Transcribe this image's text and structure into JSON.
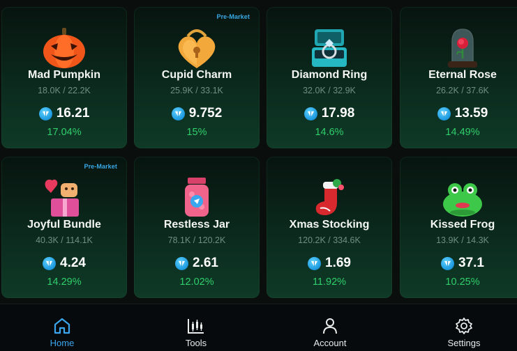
{
  "cards": [
    {
      "name": "Mad Pumpkin",
      "supply": "18.0K / 22.2K",
      "price": "16.21",
      "change": "17.04%",
      "badge": "",
      "icon": "pumpkin-icon"
    },
    {
      "name": "Cupid Charm",
      "supply": "25.9K / 33.1K",
      "price": "9.752",
      "change": "15%",
      "badge": "Pre-Market",
      "icon": "heart-lock-icon"
    },
    {
      "name": "Diamond Ring",
      "supply": "32.0K / 32.9K",
      "price": "17.98",
      "change": "14.6%",
      "badge": "",
      "icon": "ring-box-icon"
    },
    {
      "name": "Eternal Rose",
      "supply": "26.2K / 37.6K",
      "price": "13.59",
      "change": "14.49%",
      "badge": "",
      "icon": "rose-dome-icon"
    },
    {
      "name": "Joyful Bundle",
      "supply": "40.3K / 114.1K",
      "price": "4.24",
      "change": "14.29%",
      "badge": "Pre-Market",
      "icon": "gift-bundle-icon"
    },
    {
      "name": "Restless Jar",
      "supply": "78.1K / 120.2K",
      "price": "2.61",
      "change": "12.02%",
      "badge": "",
      "icon": "jar-icon"
    },
    {
      "name": "Xmas Stocking",
      "supply": "120.2K / 334.6K",
      "price": "1.69",
      "change": "11.92%",
      "badge": "",
      "icon": "stocking-icon"
    },
    {
      "name": "Kissed Frog",
      "supply": "13.9K / 14.3K",
      "price": "37.1",
      "change": "10.25%",
      "badge": "",
      "icon": "frog-icon"
    }
  ],
  "nav": [
    {
      "label": "Home",
      "icon": "home-icon",
      "active": true
    },
    {
      "label": "Tools",
      "icon": "candlestick-icon",
      "active": false
    },
    {
      "label": "Account",
      "icon": "user-icon",
      "active": false
    },
    {
      "label": "Settings",
      "icon": "gear-icon",
      "active": false
    }
  ],
  "colors": {
    "accent": "#3aa6ee",
    "positive": "#2fcf6b",
    "ton": "#1f9be0",
    "badge": "#39a8e6"
  }
}
